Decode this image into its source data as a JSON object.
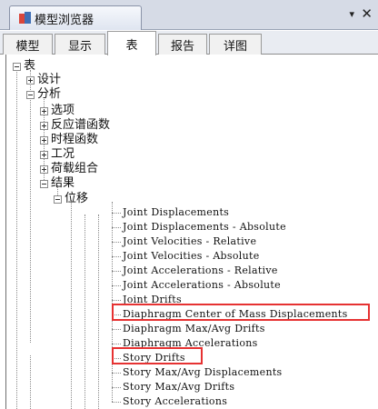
{
  "window": {
    "title": "模型浏览器",
    "dropdown_symbol": "▾",
    "close_symbol": "✕"
  },
  "tabs": [
    "模型",
    "显示",
    "表",
    "报告",
    "详图"
  ],
  "active_tab": "表",
  "tree": {
    "root": "表",
    "design": "设计",
    "analysis": "分析",
    "options": "选项",
    "response_spectrum": "反应谱函数",
    "time_history": "时程函数",
    "load_cases": "工况",
    "load_combinations": "荷载组合",
    "results": "结果",
    "displacements": "位移",
    "leaves": [
      "Joint Displacements",
      "Joint Displacements - Absolute",
      "Joint Velocities - Relative",
      "Joint Velocities - Absolute",
      "Joint Accelerations - Relative",
      "Joint Accelerations - Absolute",
      "Joint Drifts",
      "Diaphragm Center of Mass Displacements",
      "Diaphragm Max/Avg Drifts",
      "Diaphragm Accelerations",
      "Story Drifts",
      "Story Max/Avg Displacements",
      "Story Max/Avg Drifts",
      "Story Accelerations"
    ]
  },
  "highlighted_items": [
    "Diaphragm Center of Mass Displacements",
    "Story Drifts"
  ],
  "colors": {
    "highlight": "#e63232",
    "tab_bar": "#d6dbe6"
  }
}
